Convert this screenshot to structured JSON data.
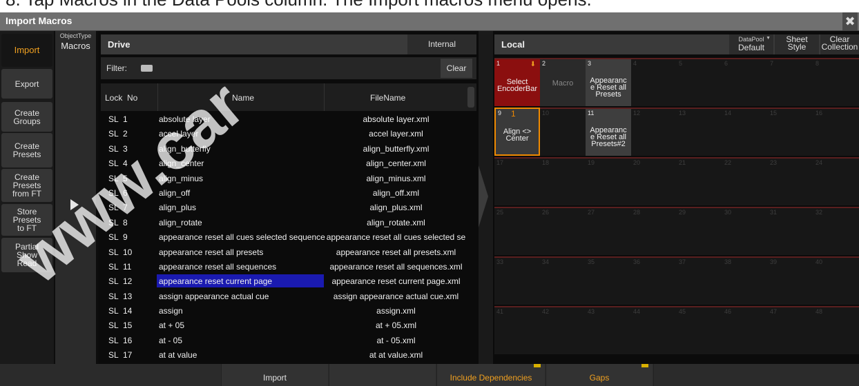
{
  "caption": "8. Tap Macros in the Data Pools column. The Import macros menu opens.",
  "window": {
    "title": "Import Macros",
    "close_glyph": "✖"
  },
  "menu": {
    "items": [
      {
        "label": "Import",
        "active": true
      },
      {
        "label": "Export"
      },
      {
        "label": "Create\nGroups"
      },
      {
        "label": "Create\nPresets"
      },
      {
        "label": "Create\nPresets\nfrom FT"
      },
      {
        "label": "Store\nPresets\nto FT"
      },
      {
        "label": "Partial\nShow\nRead"
      }
    ]
  },
  "object_type": {
    "header": "ObjectType",
    "value": "Macros"
  },
  "drive": {
    "title": "Drive",
    "location": "Internal",
    "filter_label": "Filter:",
    "clear_label": "Clear",
    "columns": {
      "lock": "Lock",
      "no": "No",
      "name": "Name",
      "filename": "FileName"
    },
    "rows": [
      {
        "lock": "SL",
        "no": "1",
        "name": "absolute layer",
        "file": "absolute layer.xml"
      },
      {
        "lock": "SL",
        "no": "2",
        "name": "accel layer",
        "file": "accel layer.xml"
      },
      {
        "lock": "SL",
        "no": "3",
        "name": "align_butterfly",
        "file": "align_butterfly.xml"
      },
      {
        "lock": "SL",
        "no": "4",
        "name": "align_center",
        "file": "align_center.xml"
      },
      {
        "lock": "SL",
        "no": "5",
        "name": "align_minus",
        "file": "align_minus.xml"
      },
      {
        "lock": "SL",
        "no": "6",
        "name": "align_off",
        "file": "align_off.xml"
      },
      {
        "lock": "SL",
        "no": "7",
        "name": "align_plus",
        "file": "align_plus.xml"
      },
      {
        "lock": "SL",
        "no": "8",
        "name": "align_rotate",
        "file": "align_rotate.xml"
      },
      {
        "lock": "SL",
        "no": "9",
        "name": "appearance reset all cues selected sequence",
        "file": "appearance reset all cues selected se"
      },
      {
        "lock": "SL",
        "no": "10",
        "name": "appearance reset all presets",
        "file": "appearance reset all presets.xml"
      },
      {
        "lock": "SL",
        "no": "11",
        "name": "appearance reset all sequences",
        "file": "appearance reset all sequences.xml"
      },
      {
        "lock": "SL",
        "no": "12",
        "name": "appearance reset current page",
        "file": "appearance reset current page.xml",
        "selected": true
      },
      {
        "lock": "SL",
        "no": "13",
        "name": "assign appearance actual cue",
        "file": "assign appearance actual cue.xml"
      },
      {
        "lock": "SL",
        "no": "14",
        "name": "assign",
        "file": "assign.xml"
      },
      {
        "lock": "SL",
        "no": "15",
        "name": "at + 05",
        "file": "at + 05.xml"
      },
      {
        "lock": "SL",
        "no": "16",
        "name": "at - 05",
        "file": "at - 05.xml"
      },
      {
        "lock": "SL",
        "no": "17",
        "name": "at at value",
        "file": "at at value.xml"
      }
    ]
  },
  "local": {
    "title": "Local",
    "datapool_label": "DataPool",
    "datapool_value": "Default",
    "sheet_style": "Sheet\nStyle",
    "clear_collection": "Clear\nCollection",
    "cells": [
      {
        "num": "1",
        "label": "Select\nEncoderBar",
        "style": "red",
        "mark": "⬇"
      },
      {
        "num": "2",
        "label": "Macro",
        "style": "gray2"
      },
      {
        "num": "3",
        "label": "Appearanc\ne Reset all\nPresets",
        "style": "gray"
      },
      {
        "num": "9",
        "label": "Align <>\nCenter",
        "style": "orange",
        "mark2": "1"
      },
      {
        "num": "11",
        "label": "Appearanc\ne Reset all\nPresets#2",
        "style": "gray"
      }
    ]
  },
  "bottom": {
    "import": "Import",
    "include_dependencies": "Include Dependencies",
    "gaps": "Gaps"
  },
  "watermark": "www.car"
}
